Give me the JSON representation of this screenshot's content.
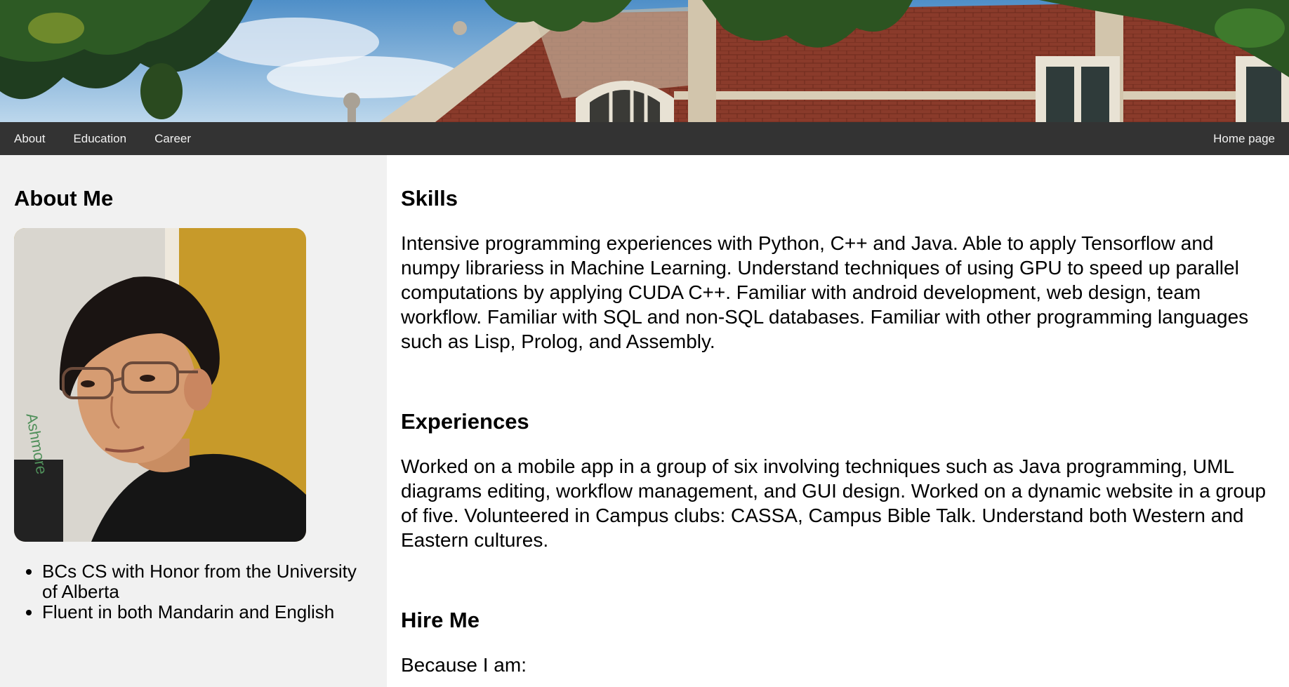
{
  "nav": {
    "left_items": [
      {
        "label": "About"
      },
      {
        "label": "Education"
      },
      {
        "label": "Career"
      }
    ],
    "right_item": {
      "label": "Home page"
    }
  },
  "sidebar": {
    "title": "About Me",
    "bullets": [
      "BCs CS with Honor from the University of Alberta",
      "Fluent in both Mandarin and English"
    ]
  },
  "main": {
    "skills_title": "Skills",
    "skills_text": "Intensive programming experiences with Python, C++ and Java. Able to apply Tensorflow and numpy librariess in Machine Learning. Understand techniques of using GPU to speed up parallel computations by applying CUDA C++. Familiar with android development, web design, team workflow. Familiar with SQL and non-SQL databases. Familiar with other programming languages such as Lisp, Prolog, and Assembly.",
    "experiences_title": "Experiences",
    "experiences_text": "Worked on a mobile app in a group of six involving techniques such as Java programming, UML diagrams editing, workflow management, and GUI design. Worked on a dynamic website in a group of five. Volunteered in Campus clubs: CASSA, Campus Bible Talk. Understand both Western and Eastern cultures.",
    "hire_title": "Hire Me",
    "hire_text": "Because I am:"
  },
  "colors": {
    "navbar": "#333333",
    "nav_text": "#f2f2f2",
    "sidebar_bg": "#f1f1f1",
    "brick": "#8b3a2a"
  }
}
